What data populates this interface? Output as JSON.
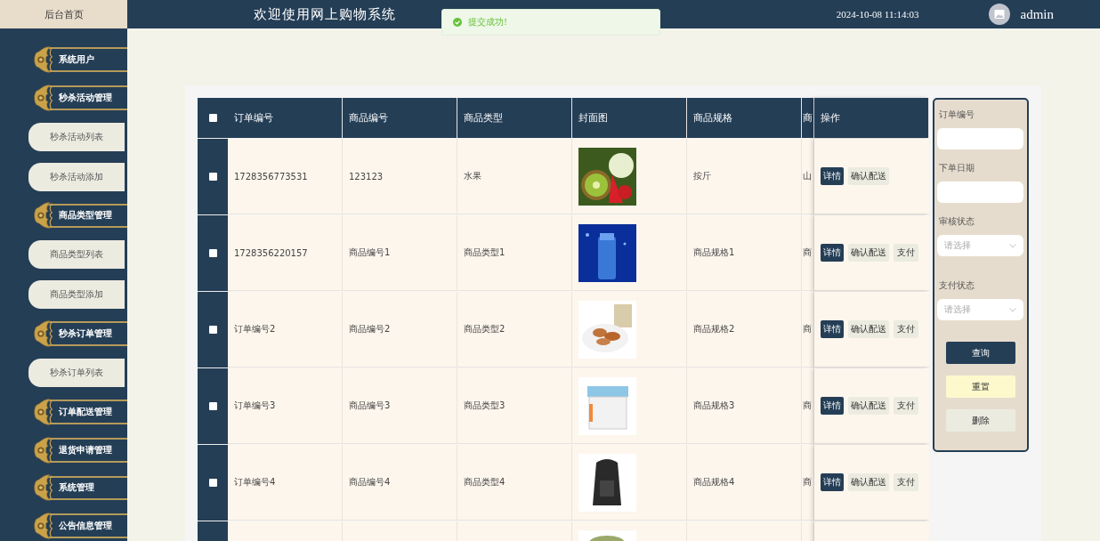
{
  "sidebar": {
    "home": "后台首页",
    "items": [
      {
        "label": "系统用户",
        "kind": "group"
      },
      {
        "label": "秒杀活动管理",
        "kind": "group"
      },
      {
        "label": "秒杀活动列表",
        "kind": "sub"
      },
      {
        "label": "秒杀活动添加",
        "kind": "sub"
      },
      {
        "label": "商品类型管理",
        "kind": "group"
      },
      {
        "label": "商品类型列表",
        "kind": "sub"
      },
      {
        "label": "商品类型添加",
        "kind": "sub"
      },
      {
        "label": "秒杀订单管理",
        "kind": "group"
      },
      {
        "label": "秒杀订单列表",
        "kind": "sub"
      },
      {
        "label": "订单配送管理",
        "kind": "group"
      },
      {
        "label": "退货申请管理",
        "kind": "group"
      },
      {
        "label": "系统管理",
        "kind": "group"
      },
      {
        "label": "公告信息管理",
        "kind": "group"
      }
    ]
  },
  "header": {
    "title": "欢迎使用网上购物系统",
    "datetime": "2024-10-08 11:14:03",
    "user": "admin"
  },
  "toast": {
    "message": "提交成功!"
  },
  "table": {
    "select_all_checked": false,
    "columns": [
      "订单编号",
      "商品编号",
      "商品类型",
      "封面图",
      "商品规格",
      "商",
      "操作"
    ],
    "rows": [
      {
        "checked": false,
        "cells": [
          "1728356773531",
          "123123",
          "水果",
          "按斤",
          "山"
        ],
        "picture": true,
        "actions": [
          {
            "label": "详情",
            "kind": "primary"
          },
          {
            "label": "确认配送",
            "kind": "plain"
          }
        ]
      },
      {
        "checked": false,
        "cells": [
          "1728356220157",
          "商品编号1",
          "商品类型1",
          "商品规格1",
          "商"
        ],
        "picture": true,
        "actions": [
          {
            "label": "详情",
            "kind": "primary"
          },
          {
            "label": "确认配送",
            "kind": "plain"
          },
          {
            "label": "支付",
            "kind": "plain"
          }
        ]
      },
      {
        "checked": false,
        "cells": [
          "订单编号2",
          "商品编号2",
          "商品类型2",
          "商品规格2",
          "商"
        ],
        "picture": true,
        "actions": [
          {
            "label": "详情",
            "kind": "primary"
          },
          {
            "label": "确认配送",
            "kind": "plain"
          },
          {
            "label": "支付",
            "kind": "plain"
          }
        ]
      },
      {
        "checked": false,
        "cells": [
          "订单编号3",
          "商品编号3",
          "商品类型3",
          "商品规格3",
          "商"
        ],
        "picture": true,
        "actions": [
          {
            "label": "详情",
            "kind": "primary"
          },
          {
            "label": "确认配送",
            "kind": "plain"
          },
          {
            "label": "支付",
            "kind": "plain"
          }
        ]
      },
      {
        "checked": false,
        "cells": [
          "订单编号4",
          "商品编号4",
          "商品类型4",
          "商品规格4",
          "商"
        ],
        "picture": true,
        "actions": [
          {
            "label": "详情",
            "kind": "primary"
          },
          {
            "label": "确认配送",
            "kind": "plain"
          },
          {
            "label": "支付",
            "kind": "plain"
          }
        ]
      },
      {
        "picture": true
      }
    ]
  },
  "filters": {
    "fields": [
      {
        "label": "订单编号",
        "kind": "text"
      },
      {
        "label": "下单日期",
        "kind": "text"
      },
      {
        "label": "审核状态",
        "kind": "select",
        "placeholder": "请选择"
      },
      {
        "label": "支付状态",
        "kind": "select",
        "placeholder": "请选择"
      }
    ],
    "buttons": [
      {
        "label": "查询",
        "kind": "search"
      },
      {
        "label": "重置",
        "kind": "reset"
      },
      {
        "label": "删除",
        "kind": "delete"
      }
    ]
  }
}
